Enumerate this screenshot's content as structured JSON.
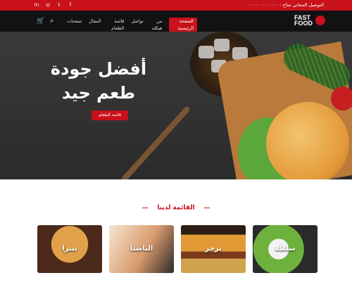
{
  "topbar": {
    "social": [
      "in",
      "◎",
      "t",
      "f"
    ],
    "contact_text": "التوصيل المجاني متاح : ٠٠٠ ٠٠٠٠ ٠٠٠٠"
  },
  "nav": {
    "brand": [
      "FAST",
      "FOOD"
    ],
    "items": [
      {
        "label": "الصفحة الرئيسية",
        "active": true
      },
      {
        "label": "من هيكله",
        "active": false
      },
      {
        "label": "تواصل",
        "active": false
      },
      {
        "label": "قائمة الطعام",
        "active": false
      },
      {
        "label": "المقال",
        "active": false
      },
      {
        "label": "صفحات",
        "active": false
      }
    ],
    "icons": [
      "search-icon",
      "cart-icon"
    ]
  },
  "hero": {
    "headline_line1": "أفضل جودة",
    "headline_line2": "طعم جيد",
    "button_label": "قائمة الطعام"
  },
  "menu_section": {
    "title": "القائمة لدينا",
    "cards": [
      {
        "label": "بيتزا"
      },
      {
        "label": "الباستا"
      },
      {
        "label": "برجر"
      },
      {
        "label": "سلطة"
      }
    ]
  },
  "colors": {
    "primary": "#c8111b",
    "nav_bg": "#121212"
  }
}
